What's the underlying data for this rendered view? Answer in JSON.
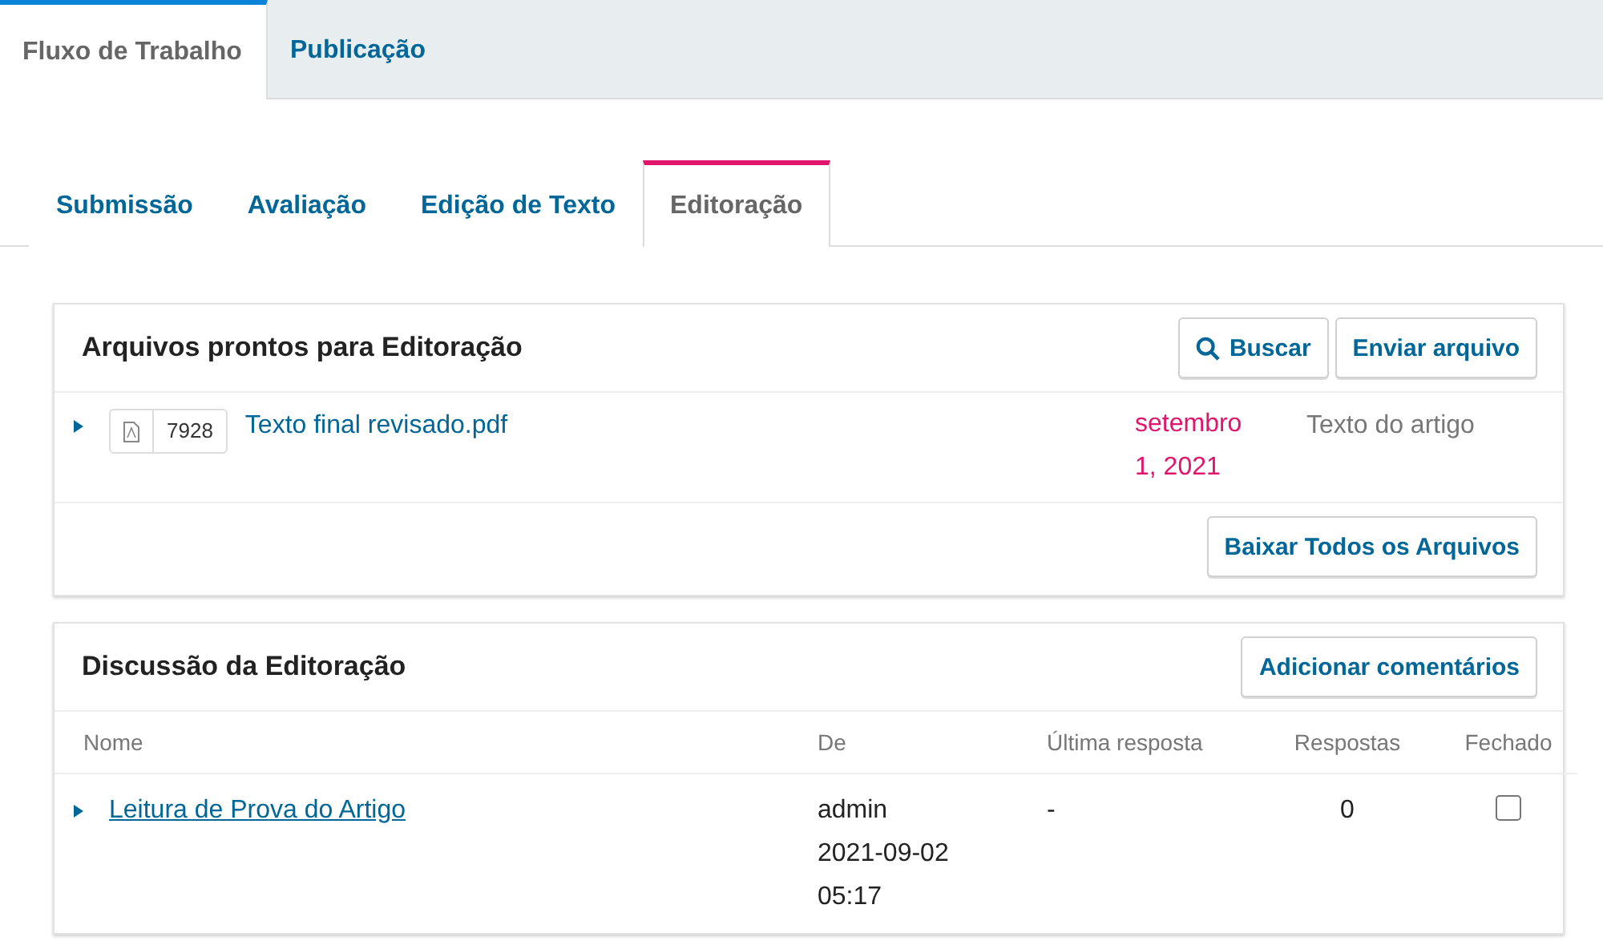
{
  "main_tabs": [
    {
      "label": "Fluxo de Trabalho",
      "selected": true
    },
    {
      "label": "Publicação",
      "selected": false
    }
  ],
  "stage_tabs": [
    {
      "label": "Submissão",
      "selected": false
    },
    {
      "label": "Avaliação",
      "selected": false
    },
    {
      "label": "Edição de Texto",
      "selected": false
    },
    {
      "label": "Editoração",
      "selected": true
    }
  ],
  "files_panel": {
    "title": "Arquivos prontos para Editoração",
    "buttons": [
      {
        "label": "Buscar",
        "kind": "search"
      },
      {
        "label": "Enviar arquivo",
        "kind": "plain"
      }
    ],
    "files": [
      {
        "id": "7928",
        "name": "Texto final revisado.pdf",
        "date": [
          "setembro",
          "1, 2021"
        ],
        "type": "Texto do artigo"
      }
    ],
    "footer_button": "Baixar Todos os Arquivos"
  },
  "discussion_panel": {
    "title": "Discussão da Editoração",
    "button": "Adicionar comentários",
    "columns": [
      "Nome",
      "De",
      "Última resposta",
      "Respostas",
      "Fechado"
    ],
    "rows": [
      {
        "name": "Leitura de Prova do Artigo",
        "from": [
          "admin",
          "2021-09-02",
          "05:17"
        ],
        "last_reply": "-",
        "replies": "0",
        "closed": false
      }
    ]
  }
}
